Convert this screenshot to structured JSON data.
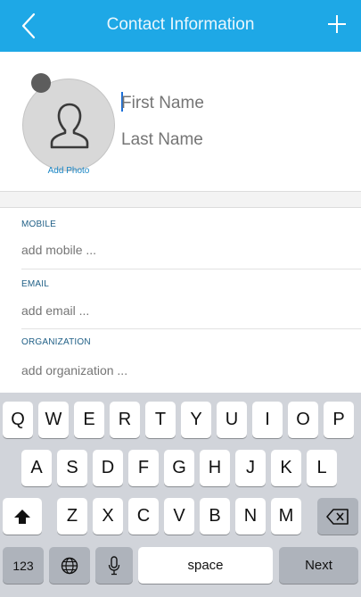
{
  "header": {
    "back_icon": "chevron-left-icon",
    "title": "Contact Information",
    "add_icon": "plus-icon",
    "color": "#1ea8e6"
  },
  "profile": {
    "avatar_icon": "person-outline-icon",
    "add_photo_label": "Add Photo",
    "first_name_placeholder": "First Name",
    "last_name_placeholder": "Last Name"
  },
  "fields": [
    {
      "label": "MOBILE",
      "placeholder": "add mobile ..."
    },
    {
      "label": "EMAIL",
      "placeholder": "add email ..."
    },
    {
      "label": "ORGANIZATION",
      "placeholder": "add organization ..."
    }
  ],
  "keyboard": {
    "row1": [
      "Q",
      "W",
      "E",
      "R",
      "T",
      "Y",
      "U",
      "I",
      "O",
      "P"
    ],
    "row2": [
      "A",
      "S",
      "D",
      "F",
      "G",
      "H",
      "J",
      "K",
      "L"
    ],
    "row3": [
      "Z",
      "X",
      "C",
      "V",
      "B",
      "N",
      "M"
    ],
    "shift_icon": "shift-arrow-icon",
    "delete_icon": "backspace-icon",
    "numbers_label": "123",
    "globe_icon": "globe-icon",
    "mic_icon": "microphone-icon",
    "space_label": "space",
    "next_label": "Next"
  }
}
